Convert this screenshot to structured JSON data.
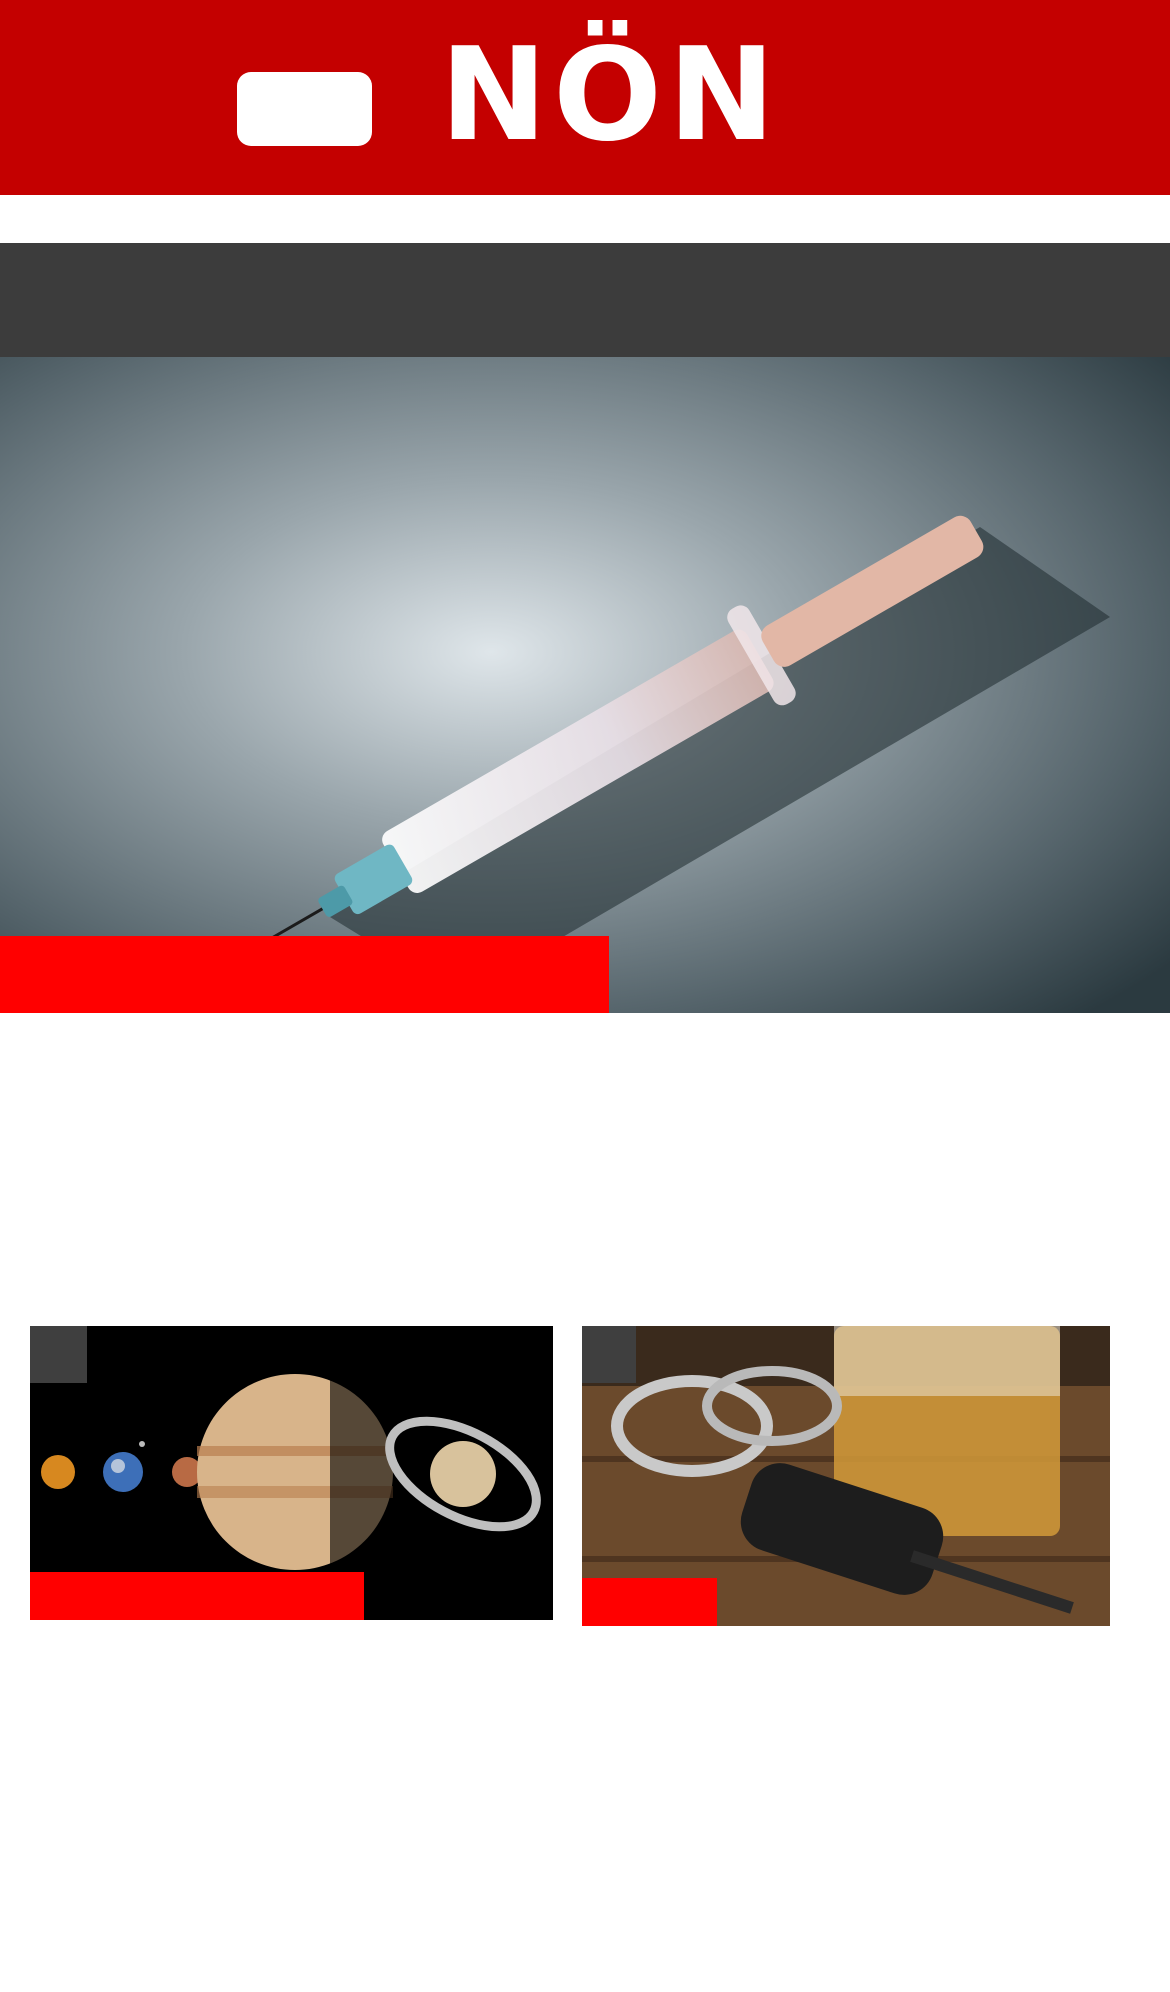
{
  "header": {
    "logo_text": "NÖN",
    "background_color": "#c40000",
    "menu_icon": "menu-pill-icon"
  },
  "subnav": {
    "background_color": "#3c3c3c"
  },
  "hero": {
    "image": "syringe-photo",
    "label_color": "#ff0000"
  },
  "cards": [
    {
      "image": "planets-photo",
      "label_color": "#ff0000"
    },
    {
      "image": "handcuffs-whisky-carkey-photo",
      "label_color": "#ff0000"
    }
  ]
}
